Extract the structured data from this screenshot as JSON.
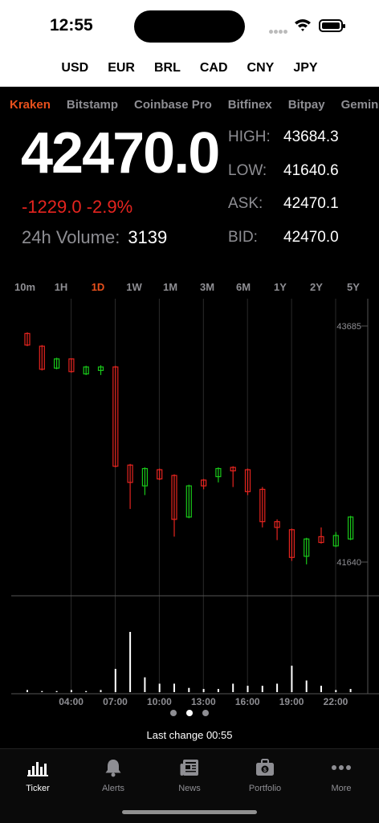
{
  "status": {
    "time": "12:55"
  },
  "currencies": [
    {
      "label": "USD",
      "active": true
    },
    {
      "label": "EUR",
      "active": false
    },
    {
      "label": "BRL",
      "active": false
    },
    {
      "label": "CAD",
      "active": false
    },
    {
      "label": "CNY",
      "active": false
    },
    {
      "label": "JPY",
      "active": false
    }
  ],
  "exchanges": [
    "Kraken",
    "Bitstamp",
    "Coinbase Pro",
    "Bitfinex",
    "Bitpay",
    "Gemini"
  ],
  "ticker": {
    "price": "42470.0",
    "change": "-1229.0 -2.9%",
    "volume_label": "24h Volume:",
    "volume_value": "3139",
    "high_label": "HIGH:",
    "high": "43684.3",
    "low_label": "LOW:",
    "low": "41640.6",
    "ask_label": "ASK:",
    "ask": "42470.1",
    "bid_label": "BID:",
    "bid": "42470.0"
  },
  "ranges": [
    "10m",
    "1H",
    "1D",
    "1W",
    "1M",
    "3M",
    "6M",
    "1Y",
    "2Y",
    "5Y"
  ],
  "active_range": "1D",
  "chart_data": {
    "type": "candlestick",
    "ylim": [
      41640,
      43685
    ],
    "y_tick_labels": [
      "43685",
      "41640"
    ],
    "x_tick_labels": [
      "04:00",
      "07:00",
      "10:00",
      "13:00",
      "16:00",
      "19:00",
      "22:00"
    ],
    "colors": {
      "up": "#19c719",
      "down": "#e5241f"
    },
    "candles": [
      {
        "o": 43620,
        "c": 43520,
        "h": 43630,
        "l": 43510
      },
      {
        "o": 43510,
        "c": 43310,
        "h": 43520,
        "l": 43300
      },
      {
        "o": 43320,
        "c": 43400,
        "h": 43410,
        "l": 43310
      },
      {
        "o": 43400,
        "c": 43290,
        "h": 43405,
        "l": 43280
      },
      {
        "o": 43270,
        "c": 43330,
        "h": 43340,
        "l": 43260
      },
      {
        "o": 43300,
        "c": 43330,
        "h": 43345,
        "l": 43260
      },
      {
        "o": 43330,
        "c": 42470,
        "h": 43340,
        "l": 42460
      },
      {
        "o": 42480,
        "c": 42330,
        "h": 42490,
        "l": 42100
      },
      {
        "o": 42300,
        "c": 42450,
        "h": 42460,
        "l": 42220
      },
      {
        "o": 42440,
        "c": 42360,
        "h": 42450,
        "l": 42350
      },
      {
        "o": 42390,
        "c": 42010,
        "h": 42400,
        "l": 41860
      },
      {
        "o": 42030,
        "c": 42300,
        "h": 42310,
        "l": 42020
      },
      {
        "o": 42350,
        "c": 42300,
        "h": 42360,
        "l": 42270
      },
      {
        "o": 42380,
        "c": 42450,
        "h": 42460,
        "l": 42330
      },
      {
        "o": 42460,
        "c": 42430,
        "h": 42470,
        "l": 42290
      },
      {
        "o": 42440,
        "c": 42250,
        "h": 42450,
        "l": 42220
      },
      {
        "o": 42270,
        "c": 41990,
        "h": 42290,
        "l": 41940
      },
      {
        "o": 41990,
        "c": 41940,
        "h": 42010,
        "l": 41830
      },
      {
        "o": 41920,
        "c": 41680,
        "h": 41930,
        "l": 41650
      },
      {
        "o": 41690,
        "c": 41840,
        "h": 41850,
        "l": 41620
      },
      {
        "o": 41860,
        "c": 41810,
        "h": 41940,
        "l": 41800
      },
      {
        "o": 41780,
        "c": 41870,
        "h": 41900,
        "l": 41770
      },
      {
        "o": 41840,
        "c": 42030,
        "h": 42040,
        "l": 41830
      }
    ],
    "volumes": [
      2,
      1,
      1,
      2,
      1,
      2,
      22,
      57,
      14,
      8,
      8,
      4,
      3,
      3,
      8,
      6,
      6,
      8,
      25,
      11,
      6,
      2,
      3
    ]
  },
  "pager": {
    "count": 3,
    "active": 1
  },
  "last_change": "Last change 00:55",
  "tabs": [
    {
      "label": "Ticker",
      "icon": "chart-bars-icon",
      "active": true
    },
    {
      "label": "Alerts",
      "icon": "bell-icon",
      "active": false
    },
    {
      "label": "News",
      "icon": "newspaper-icon",
      "active": false
    },
    {
      "label": "Portfolio",
      "icon": "briefcase-icon",
      "active": false
    },
    {
      "label": "More",
      "icon": "ellipsis-icon",
      "active": false
    }
  ]
}
